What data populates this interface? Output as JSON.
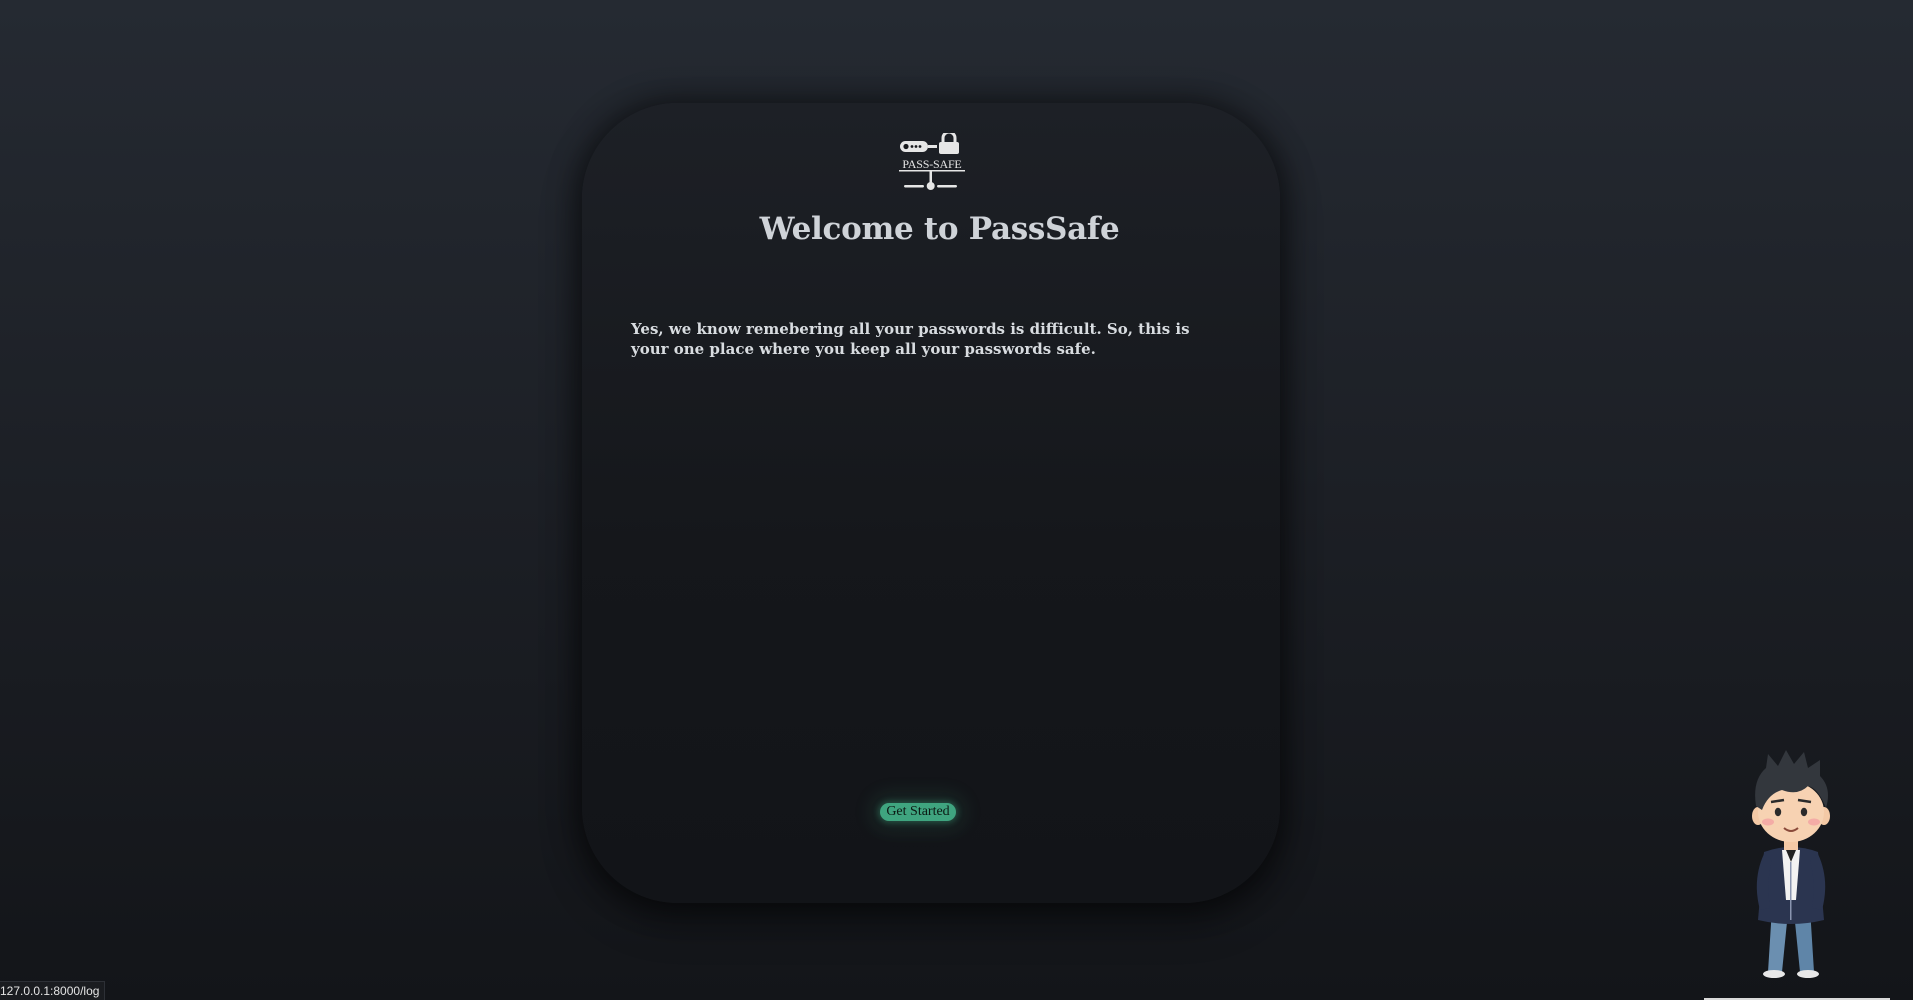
{
  "logo": {
    "text": "PASS-SAFE",
    "icon": "pass-safe-logo-icon"
  },
  "main": {
    "title": "Welcome to PassSafe",
    "description": "Yes, we know remebering all your passwords is difficult. So, this is your one place where you keep all your passwords safe.",
    "cta_label": "Get Started"
  },
  "status_bar": {
    "url": "127.0.0.1:8000/log"
  },
  "mascot": {
    "icon": "cartoon-boy-mascot"
  },
  "colors": {
    "accent": "#3fa47f",
    "card_bg": "#16181c",
    "page_bg": "#22262d",
    "text": "#cfd3d8"
  }
}
